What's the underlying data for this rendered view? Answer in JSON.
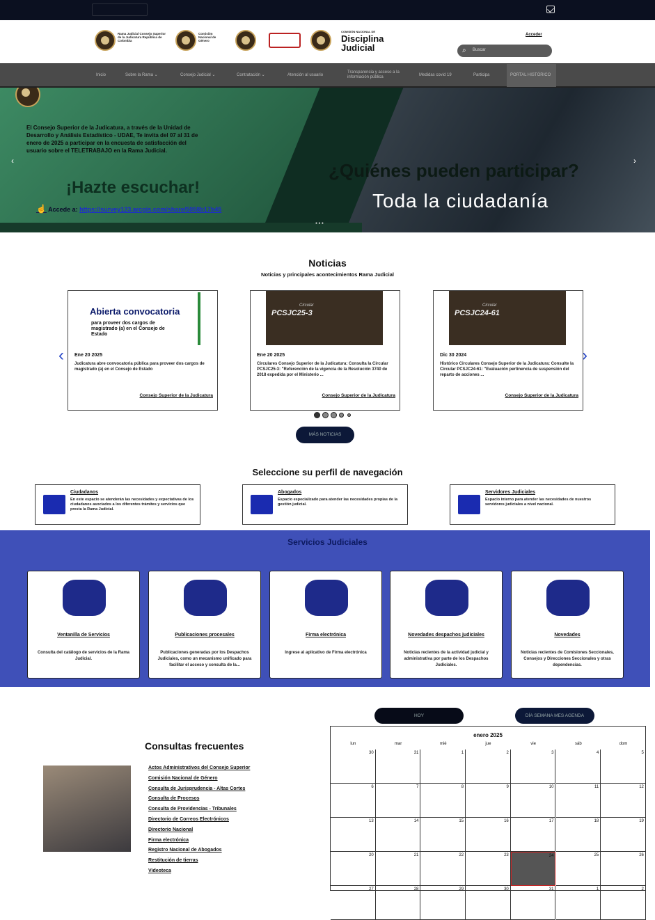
{
  "header": {
    "logos": [
      "Rama Judicial Consejo Superior de la Judicatura República de Colombia",
      "Comisión Nacional de Género"
    ],
    "disciplina_small": "COMISIÓN NACIONAL DE",
    "disciplina_title_1": "Disciplina",
    "disciplina_title_2": "Judicial",
    "acceder": "Acceder",
    "search_placeholder": "Buscar"
  },
  "nav": {
    "items": [
      "Inicio",
      "Sobre la Rama ⌄",
      "Consejo Judicial ⌄",
      "Contratación ⌄",
      "Atención al usuario",
      "Transparencia y acceso a la información pública",
      "Medidas covid 19",
      "Participa",
      "PORTAL HISTÓRICO"
    ]
  },
  "hero": {
    "intro": "El Consejo Superior de la Judicatura, a través de la Unidad de Desarrollo y Análisis Estadístico - UDAE, Te invita del 07 al 31 de enero de 2025 a participar en la encuesta de satisfacción del usuario sobre el TELETRABAJO en la Rama Judicial.",
    "headline": "¡Hazte escuchar!",
    "link_prefix": "Accede a:",
    "link": "https://survey123.arcgis.com/share/5058b17b45",
    "question": "¿Quiénes pueden participar?",
    "answer": "Toda la ciudadanía"
  },
  "news": {
    "title": "Noticias",
    "subtitle": "Noticias y principales acontecimientos Rama Judicial",
    "cards": [
      {
        "img_title": "Abierta convocatoria",
        "img_sub": "para proveer dos cargos de magistrado (a) en el Consejo de Estado",
        "date": "Ene 20 2025",
        "desc": "Judicatura abre convocatoria pública para proveer dos cargos de magistrado (a) en el Consejo de Estado",
        "source": "Consejo Superior de la Judicatura"
      },
      {
        "img_title": "PCSJC25-3",
        "img_sub": "Circular",
        "date": "Ene 20 2025",
        "desc": "Circulares Consejo Superior de la Judicatura: Consulta la Circular PCSJC25-3: \"Referención de la vigencia de la Resolución 3740 de 2018 expedida por el Ministerio ...",
        "source": "Consejo Superior de la Judicatura"
      },
      {
        "img_title": "PCSJC24-61",
        "img_sub": "Circular",
        "date": "Dic 30 2024",
        "desc": "Histórico Circulares Consejo Superior de la Judicatura: Consulte la Circular PCSJC24-61: \"Evaluación pertinencia de suspensión del reparto de acciones ...",
        "source": "Consejo Superior de la Judicatura"
      }
    ],
    "more_button": "MÁS NOTICIAS"
  },
  "profiles": {
    "title": "Seleccione su perfil de navegación",
    "items": [
      {
        "title": "Ciudadanos",
        "desc": "En este espacio se atenderán las necesidades y expectativas de los ciudadanos asociados a los diferentes trámites y servicios que presta la Rama Judicial."
      },
      {
        "title": "Abogados",
        "desc": "Espacio especializado para atender las necesidades propias de la gestión judicial."
      },
      {
        "title": "Servidores Judiciales",
        "desc": "Espacio interno para atender las necesidades de nuestros servidores judiciales a nivel nacional."
      }
    ]
  },
  "services": {
    "title": "Servicios Judiciales",
    "items": [
      {
        "title": "Ventanilla de Servicios",
        "desc": "Consulta del catálogo de servicios de la Rama Judicial."
      },
      {
        "title": "Publicaciones procesales",
        "desc": "Publicaciones generadas por los Despachos Judiciales, como un mecanismo unificado para facilitar el acceso y consulta de la..."
      },
      {
        "title": "Firma electrónica",
        "desc": "Ingrese al aplicativo de Firma electrónica"
      },
      {
        "title": "Novedades despachos judiciales",
        "desc": "Noticias recientes de la actividad judicial y administrativa por parte de los Despachos Judiciales."
      },
      {
        "title": "Novedades",
        "desc": "Noticias recientes de Comisiones Seccionales, Consejos y Direcciones Seccionales y otras dependencias."
      }
    ]
  },
  "faq": {
    "title": "Consultas frecuentes",
    "links": [
      "Actos Administrativos del Consejo Superior",
      "Comisión Nacional de Género",
      "Consulta de Jurisprudencia - Altas Cortes",
      "Consulta de Procesos",
      "Consulta de Providencias - Tribunales",
      "Directorio de Correos Electrónicos",
      "Directorio Nacional",
      "Firma electrónica",
      "Registro Nacional de Abogados",
      "Restitución de tierras",
      "Videoteca"
    ]
  },
  "calendar": {
    "today_button": "HOY",
    "views_button": "DÍA SEMANA MES AGENDA",
    "month": "enero 2025",
    "days": [
      "lun",
      "mar",
      "mié",
      "jue",
      "vie",
      "sáb",
      "dom"
    ],
    "weeks": [
      [
        "30",
        "31",
        "1",
        "2",
        "3",
        "4",
        "5"
      ],
      [
        "6",
        "7",
        "8",
        "9",
        "10",
        "11",
        "12"
      ],
      [
        "13",
        "14",
        "15",
        "16",
        "17",
        "18",
        "19"
      ],
      [
        "20",
        "21",
        "22",
        "23",
        "24",
        "25",
        "26"
      ],
      [
        "27",
        "28",
        "29",
        "30",
        "31",
        "1",
        "2"
      ]
    ]
  }
}
